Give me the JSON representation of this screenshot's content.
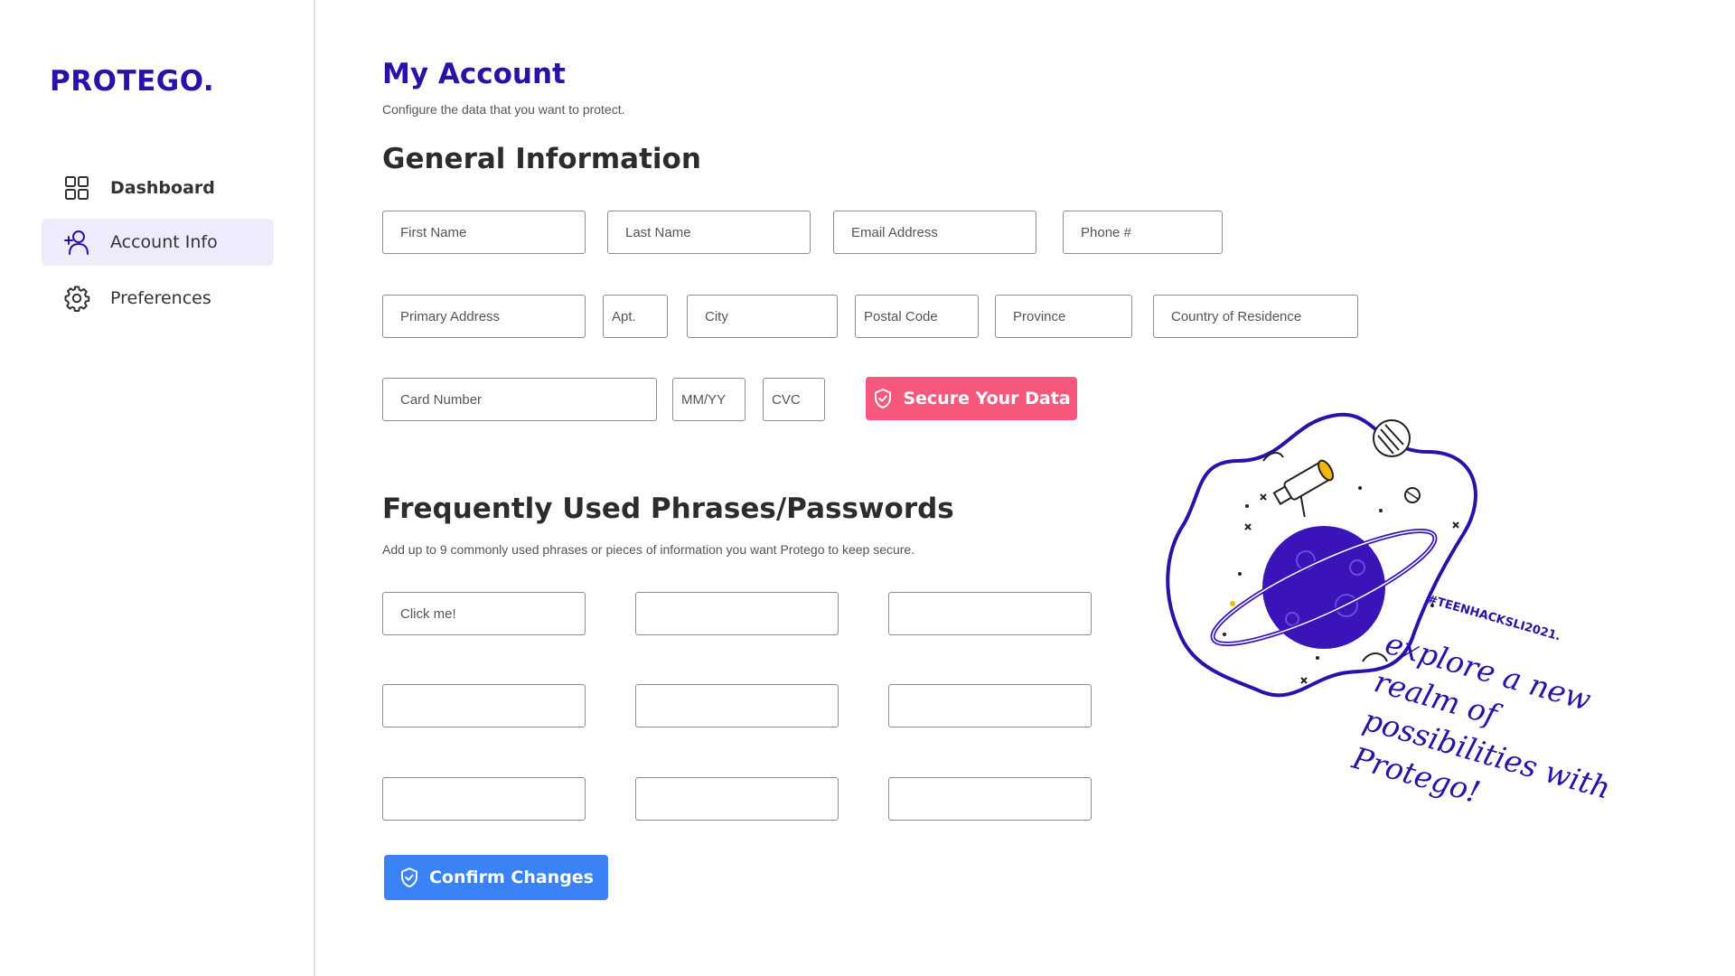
{
  "brand": {
    "logo": "PROTEGO.",
    "color": "#2a12a8"
  },
  "sidebar": {
    "items": [
      {
        "label": "Dashboard",
        "icon": "grid-icon",
        "active": false
      },
      {
        "label": "Account Info",
        "icon": "add-user-icon",
        "active": true
      },
      {
        "label": "Preferences",
        "icon": "gear-icon",
        "active": false
      }
    ]
  },
  "header": {
    "title": "My Account",
    "subtitle": "Configure the data that you want to protect."
  },
  "general": {
    "title": "General Information",
    "fields": {
      "first_name": "First Name",
      "last_name": "Last Name",
      "email": "Email Address",
      "phone": "Phone #",
      "address": "Primary Address",
      "apt": "Apt.",
      "city": "City",
      "postal": "Postal Code",
      "province": "Province",
      "country": "Country of Residence",
      "card": "Card Number",
      "expiry": "MM/YY",
      "cvc": "CVC"
    },
    "secure_button": "Secure Your Data"
  },
  "phrases": {
    "title": "Frequently Used Phrases/Passwords",
    "description": "Add up to 9 commonly used phrases or pieces of information you want Protego to keep secure.",
    "inputs": [
      "Click me!",
      "",
      "",
      "",
      "",
      "",
      "",
      "",
      ""
    ]
  },
  "confirm_button": "Confirm Changes",
  "promo": {
    "hashtag": "#TEENHACKSLI2021.",
    "tagline": "explore a new realm of possibilities with Protego!"
  },
  "colors": {
    "accent": "#2a12a8",
    "secure_button": "#f5577d",
    "confirm_button": "#3b82f6",
    "active_nav": "#eeebfd"
  }
}
